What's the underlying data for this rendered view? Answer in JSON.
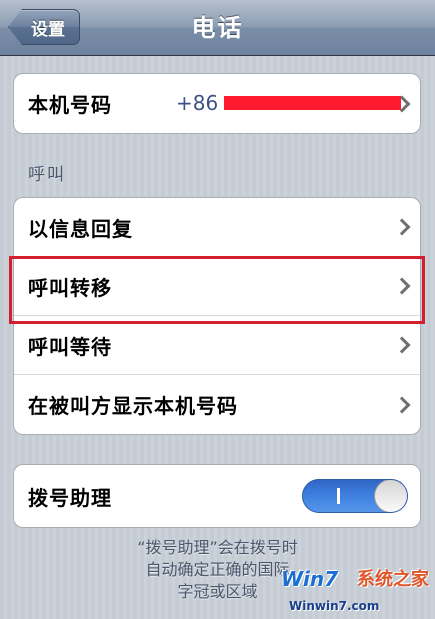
{
  "navbar": {
    "back_label": "设置",
    "title": "电话"
  },
  "phone_number": {
    "label": "本机号码",
    "value": "+86"
  },
  "call_section": {
    "header": "呼叫",
    "items": [
      {
        "label": "以信息回复"
      },
      {
        "label": "呼叫转移"
      },
      {
        "label": "呼叫等待"
      },
      {
        "label": "在被叫方显示本机号码"
      }
    ]
  },
  "dial_assist": {
    "label": "拨号助理",
    "toggle_state": "on",
    "footer_lines": [
      "“拨号助理”会在拨号时",
      "自动确定正确的国际",
      "字冠或区域"
    ]
  },
  "watermark": {
    "logo": "Win7",
    "brand": "系统之家",
    "url": "Winwin7.com"
  },
  "colors": {
    "highlight": "#d4202e",
    "redaction": "#ff1a2e",
    "toggle_on": "#3f80e0",
    "value_text": "#3c5388"
  }
}
